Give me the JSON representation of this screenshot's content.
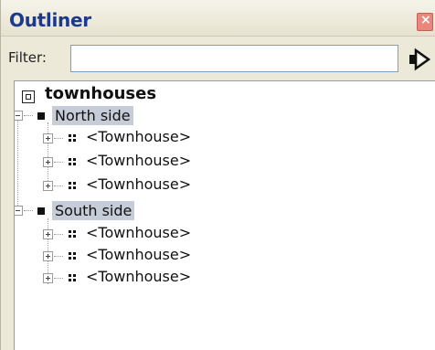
{
  "window": {
    "title": "Outliner",
    "close_glyph": "×"
  },
  "filter": {
    "label": "Filter:",
    "value": "",
    "placeholder": ""
  },
  "tree": {
    "root": {
      "label": "townhouses",
      "icon": "scene-root-icon"
    },
    "groups": [
      {
        "label": "North side",
        "expanded": true,
        "items": [
          "<Townhouse>",
          "<Townhouse>",
          "<Townhouse>"
        ]
      },
      {
        "label": "South side",
        "expanded": true,
        "items": [
          "<Townhouse>",
          "<Townhouse>",
          "<Townhouse>"
        ]
      }
    ]
  },
  "colors": {
    "title": "#1c3a8c",
    "selection": "#c7cdd8",
    "close": "#e9877c"
  }
}
